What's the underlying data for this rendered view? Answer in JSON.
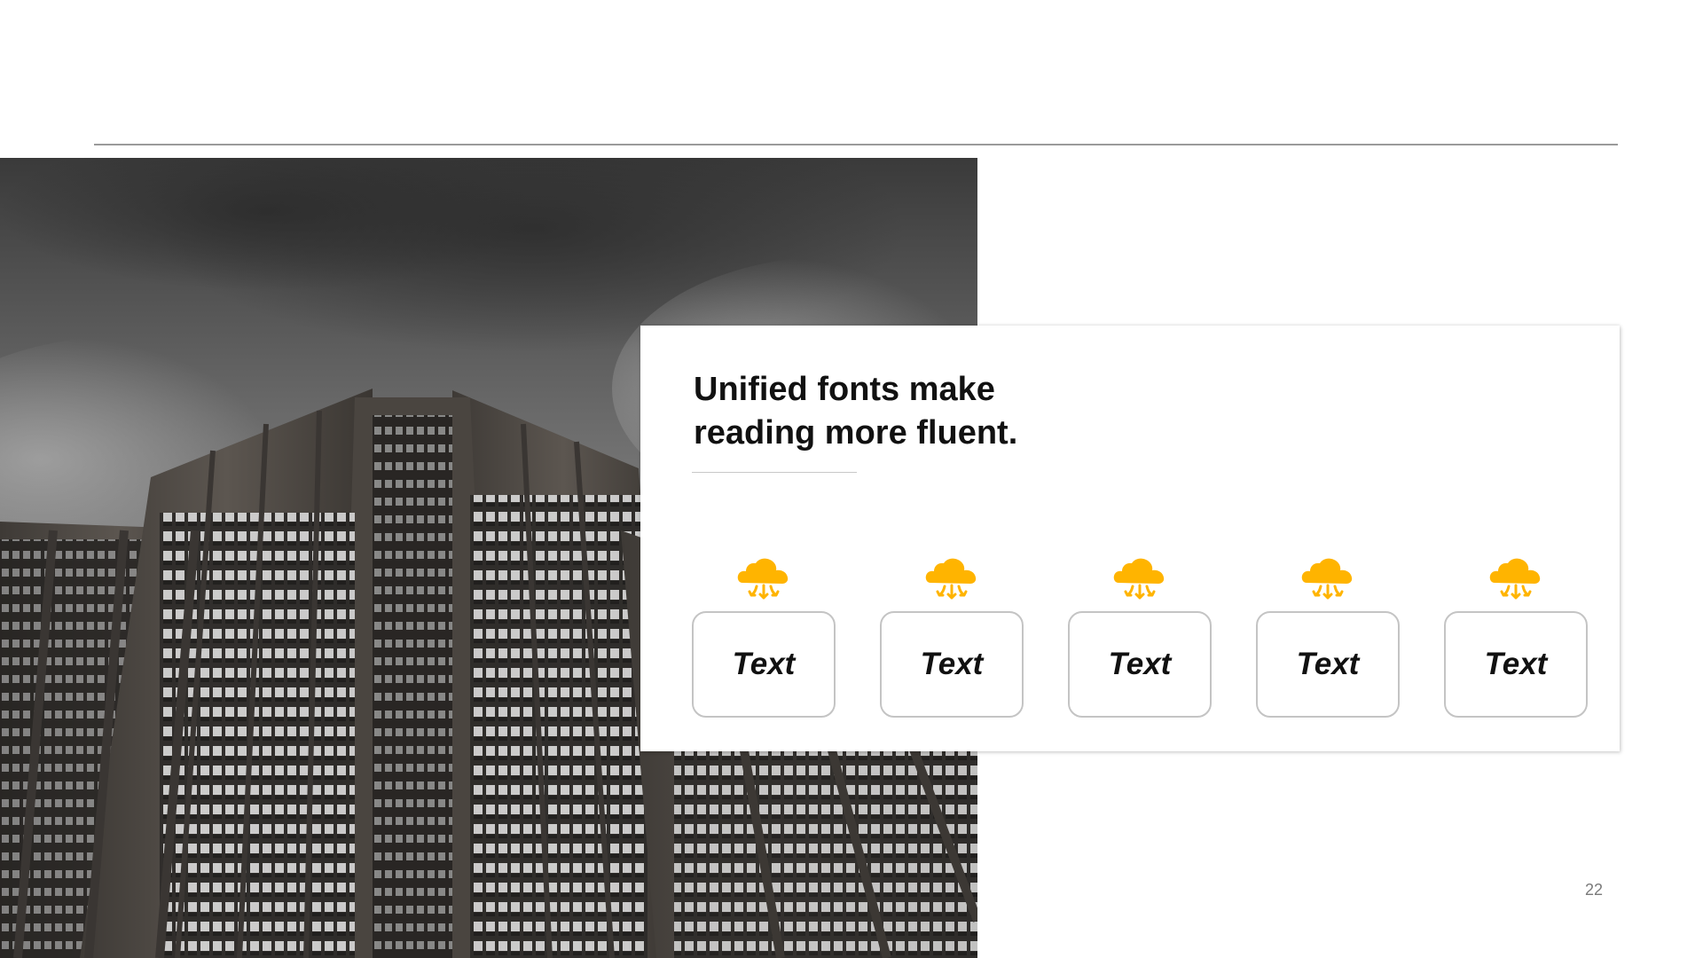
{
  "slide": {
    "heading_lines": [
      "Unified fonts make",
      "reading more fluent."
    ],
    "page_number": "22"
  },
  "items": [
    {
      "label": "Text",
      "icon": "cloud-download-icon"
    },
    {
      "label": "Text",
      "icon": "cloud-download-icon"
    },
    {
      "label": "Text",
      "icon": "cloud-download-icon"
    },
    {
      "label": "Text",
      "icon": "cloud-download-icon"
    },
    {
      "label": "Text",
      "icon": "cloud-download-icon"
    }
  ],
  "colors": {
    "accent": "#FFB400",
    "heading": "#111111",
    "box_border": "#C4C4C4",
    "rule": "#9A9A9A",
    "page_number": "#7A7A7A"
  },
  "image": {
    "subject": "skyscraper-photo",
    "style": "monochrome"
  }
}
